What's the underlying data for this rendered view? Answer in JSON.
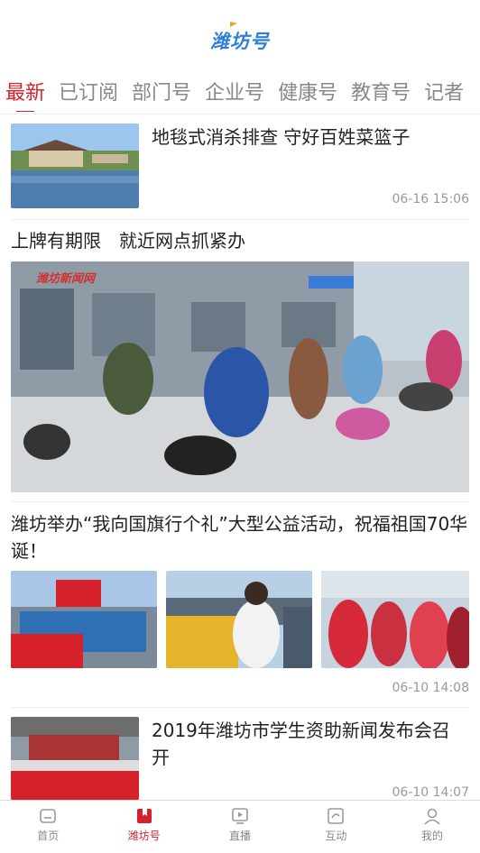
{
  "header": {
    "logo_text": "潍坊号"
  },
  "tabs": [
    {
      "label": "最新",
      "active": true
    },
    {
      "label": "已订阅"
    },
    {
      "label": "部门号"
    },
    {
      "label": "企业号"
    },
    {
      "label": "健康号"
    },
    {
      "label": "教育号"
    },
    {
      "label": "记者"
    }
  ],
  "feed": [
    {
      "title": "地毯式消杀排查 守好百姓菜篮子",
      "time": "06-16 15:06"
    },
    {
      "title": "上牌有期限　就近网点抓紧办",
      "watermark": "潍坊新闻网"
    },
    {
      "title": "潍坊举办“我向国旗行个礼”大型公益活动，祝福祖国70华诞！",
      "time": "06-10 14:08"
    },
    {
      "title": "2019年潍坊市学生资助新闻发布会召开",
      "time": "06-10 14:07"
    }
  ],
  "bottom_nav": [
    {
      "label": "首页",
      "icon": "home-icon"
    },
    {
      "label": "潍坊号",
      "icon": "bookmark-icon",
      "active": true
    },
    {
      "label": "直播",
      "icon": "tv-icon"
    },
    {
      "label": "互动",
      "icon": "chat-icon"
    },
    {
      "label": "我的",
      "icon": "user-icon"
    }
  ],
  "colors": {
    "accent": "#d6212a",
    "logo": "#2f7fd6"
  }
}
